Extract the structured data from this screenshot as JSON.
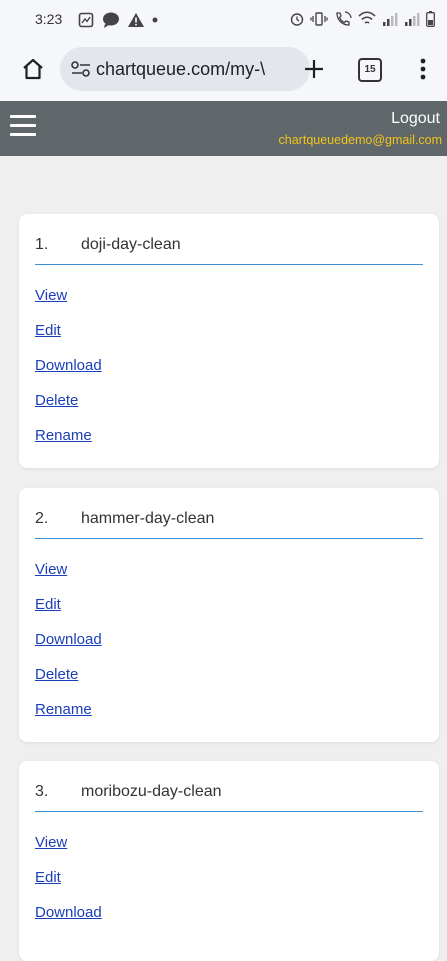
{
  "status_bar": {
    "time": "3:23",
    "left_icons": [
      "screenshot-icon",
      "chat-icon",
      "alert-triangle-icon",
      "dot-icon"
    ],
    "right_icons": [
      "alarm-icon",
      "vibrate-icon",
      "wifi-calling-icon",
      "wifi-icon",
      "signal-icon",
      "signal-icon",
      "battery-icon"
    ]
  },
  "browser": {
    "url": "chartqueue.com/my-\\",
    "tab_count": "15"
  },
  "header": {
    "logout_label": "Logout",
    "email": "chartqueuedemo@gmail.com"
  },
  "charts": [
    {
      "number": "1.",
      "name": "doji-day-clean",
      "links": [
        "View",
        "Edit",
        "Download",
        "Delete",
        "Rename"
      ]
    },
    {
      "number": "2.",
      "name": "hammer-day-clean",
      "links": [
        "View",
        "Edit",
        "Download",
        "Delete",
        "Rename"
      ]
    },
    {
      "number": "3.",
      "name": "moribozu-day-clean",
      "links": [
        "View",
        "Edit",
        "Download"
      ]
    }
  ],
  "colors": {
    "header_bg": "#60676b",
    "email": "#f0c419",
    "link": "#1a3fb8",
    "rule": "#3d8fd6",
    "page_bg": "#efefef"
  }
}
